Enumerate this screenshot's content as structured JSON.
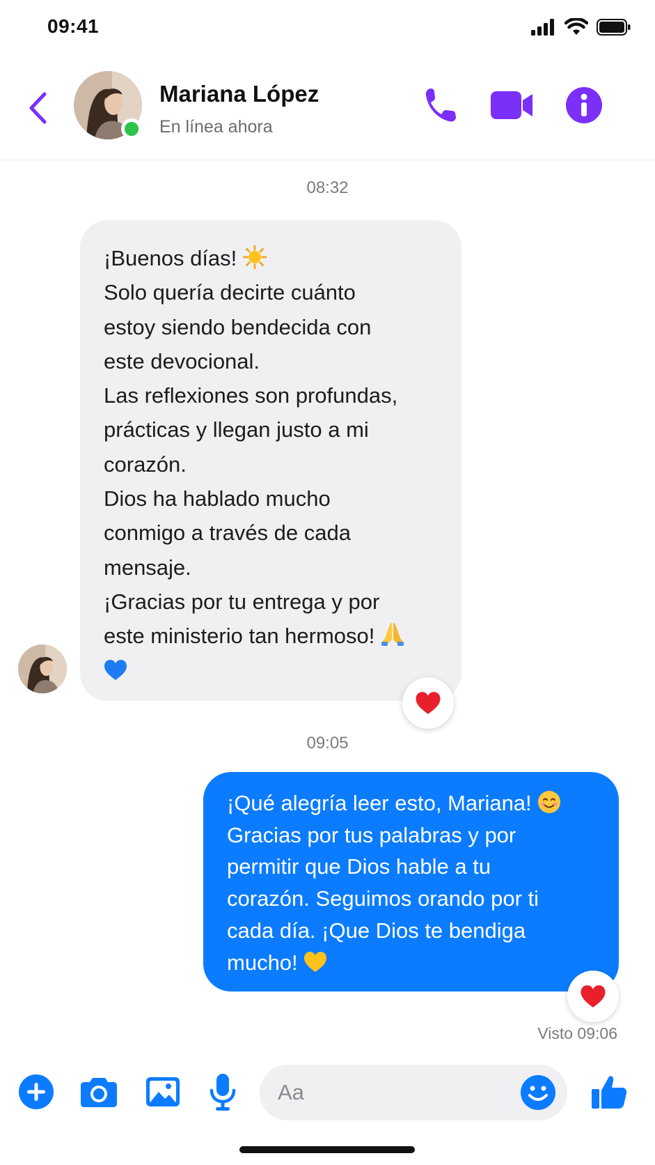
{
  "status_bar": {
    "time": "09:41"
  },
  "header": {
    "back_icon": "chevron-left-icon",
    "contact_name": "Mariana López",
    "contact_status": "En línea ahora",
    "icons": [
      "phone-icon",
      "video-camera-icon",
      "info-icon"
    ],
    "accent_color": "#7b2ff7"
  },
  "messages": {
    "incoming": {
      "timestamp": "08:32",
      "lines": [
        "¡Buenos días!",
        "Solo quería decirte cuánto",
        "estoy siendo bendecida con",
        "este devocional.",
        "Las reflexiones son profundas,",
        "prácticas y llegan justo a mi",
        "corazón.",
        "Dios ha hablado mucho",
        "conmigo a través de cada",
        "mensaje.",
        "¡Gracias por tu entrega y por",
        "este ministerio tan hermoso!"
      ],
      "emojis": [
        "sun-emoji",
        "praying-hands-emoji",
        "blue-heart-emoji"
      ],
      "reaction": "red-heart-emoji"
    },
    "outgoing": {
      "timestamp": "09:05",
      "lines": [
        "¡Qué alegría leer esto, Mariana!",
        "Gracias por tus palabras y por",
        "permitir que Dios hable a tu",
        "corazón. Seguimos orando por ti",
        "cada día. ¡Que Dios te bendiga",
        "mucho!"
      ],
      "emojis": [
        "smiling-face-emoji",
        "yellow-heart-emoji"
      ],
      "reaction": "red-heart-emoji",
      "seen": "Visto 09:06",
      "bubble_color": "#0b7cff"
    }
  },
  "composer": {
    "placeholder": "Aa",
    "icons": [
      "plus-icon",
      "camera-icon",
      "image-icon",
      "microphone-icon",
      "emoji-icon",
      "thumbs-up-icon"
    ],
    "icon_color": "#0b7cff"
  }
}
